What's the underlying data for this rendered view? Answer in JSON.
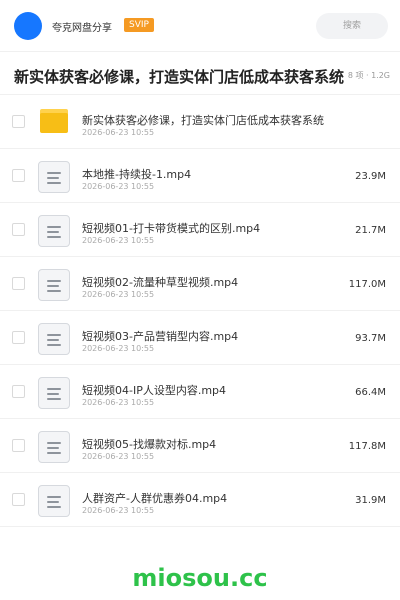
{
  "header": {
    "app_title": "夸克网盘分享",
    "vip_badge": "SVIP",
    "search_placeholder": "搜索"
  },
  "share": {
    "title": "新实体获客必修课，打造实体门店低成本获客系统",
    "meta": "8 项 · 1.2G"
  },
  "files": [
    {
      "type": "folder",
      "name": "新实体获客必修课，打造实体门店低成本获客系统",
      "date": "2026-06-23 10:55",
      "size": ""
    },
    {
      "type": "file",
      "name": "本地推-持续投-1.mp4",
      "date": "2026-06-23 10:55",
      "size": "23.9M"
    },
    {
      "type": "file",
      "name": "短视频01-打卡带货模式的区别.mp4",
      "date": "2026-06-23 10:55",
      "size": "21.7M"
    },
    {
      "type": "file",
      "name": "短视频02-流量种草型视频.mp4",
      "date": "2026-06-23 10:55",
      "size": "117.0M"
    },
    {
      "type": "file",
      "name": "短视频03-产品营销型内容.mp4",
      "date": "2026-06-23 10:55",
      "size": "93.7M"
    },
    {
      "type": "file",
      "name": "短视频04-IP人设型内容.mp4",
      "date": "2026-06-23 10:55",
      "size": "66.4M"
    },
    {
      "type": "file",
      "name": "短视频05-找爆款对标.mp4",
      "date": "2026-06-23 10:55",
      "size": "117.8M"
    },
    {
      "type": "file",
      "name": "人群资产-人群优惠券04.mp4",
      "date": "2026-06-23 10:55",
      "size": "31.9M"
    }
  ],
  "watermark": "miosou.cc",
  "colors": {
    "accent": "#1677ff",
    "vip": "#f59a23",
    "folder": "#f7be16",
    "watermark": "#2ec24a"
  },
  "icons": {
    "folder": "folder-icon",
    "file": "video-file-icon"
  }
}
